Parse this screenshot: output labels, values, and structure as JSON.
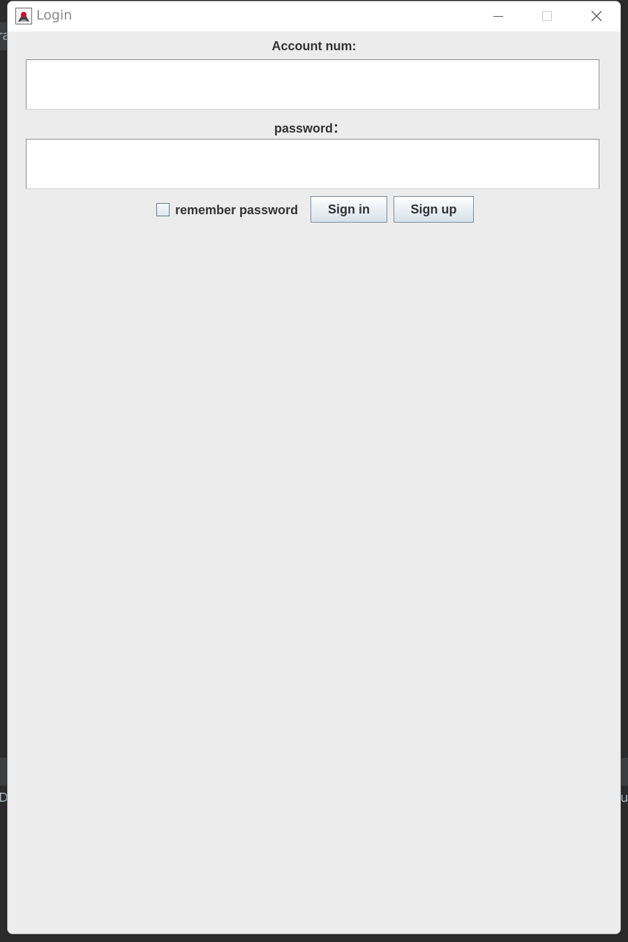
{
  "window": {
    "title": "Login",
    "app_icon": "java-icon",
    "controls": [
      "minimize-icon",
      "maximize-icon",
      "close-icon"
    ]
  },
  "form": {
    "account_label": "Account num:",
    "account_value": "",
    "password_label": "password：",
    "password_value": "",
    "remember_label": "remember password",
    "remember_checked": false,
    "signin_label": "Sign in",
    "signup_label": "Sign up"
  },
  "background": {
    "fragment_left_top": "ra",
    "fragment_left_bottom": "D",
    "fragment_right_bottom": "u"
  },
  "colors": {
    "window_bg": "#ececec",
    "titlebar_bg": "#ffffff",
    "button_border": "#7a8a99"
  }
}
